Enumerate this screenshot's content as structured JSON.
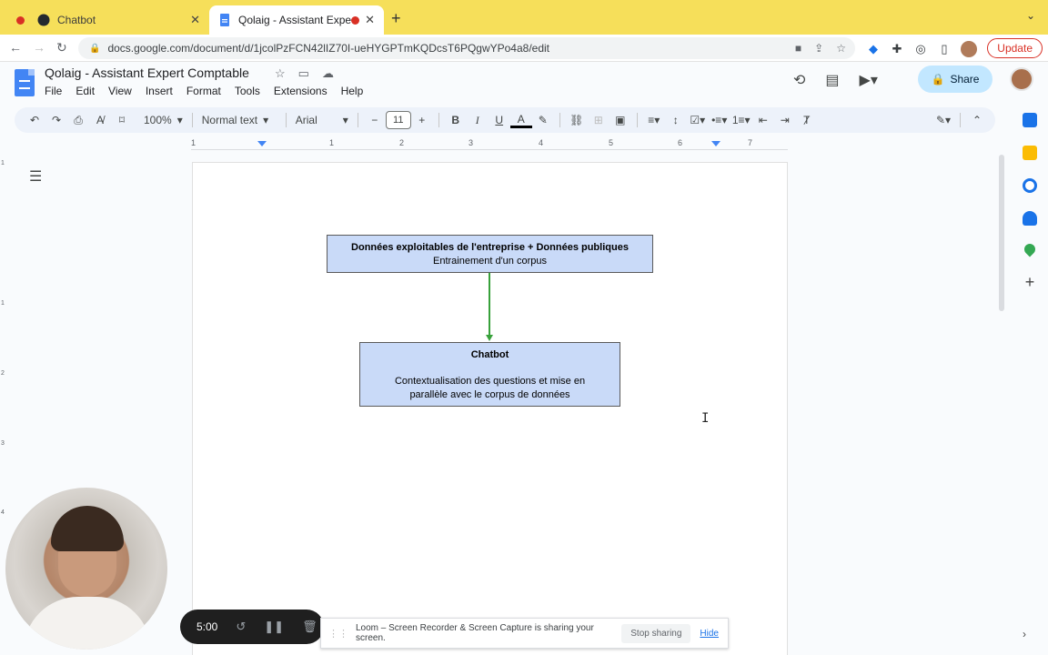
{
  "browser": {
    "tabs": [
      {
        "title": "Chatbot",
        "active": false
      },
      {
        "title": "Qolaig - Assistant Expert Co",
        "active": true
      }
    ],
    "url": "docs.google.com/document/d/1jcolPzFCN42lIZ70I-ueHYGPTmKQDcsT6PQgwYPo4a8/edit",
    "update_label": "Update"
  },
  "docs": {
    "title": "Qolaig - Assistant Expert Comptable",
    "menu": [
      "File",
      "Edit",
      "View",
      "Insert",
      "Format",
      "Tools",
      "Extensions",
      "Help"
    ],
    "share_label": "Share",
    "toolbar": {
      "zoom": "100%",
      "style": "Normal text",
      "font": "Arial",
      "font_size": "11"
    },
    "ruler_numbers": [
      "1",
      "1",
      "2",
      "3",
      "4",
      "5",
      "6",
      "7"
    ],
    "vruler_numbers": [
      "1",
      "1",
      "2",
      "3",
      "4"
    ]
  },
  "diagram": {
    "box1": {
      "title": "Données exploitables de l'entreprise + Données publiques",
      "subtitle": "Entrainement d'un corpus"
    },
    "box2": {
      "title": "Chatbot",
      "line1": "Contextualisation des questions et mise en",
      "line2": "parallèle avec le corpus de données"
    },
    "connector_color": "#38a13b",
    "box_fill": "#c9daf8"
  },
  "loom": {
    "timer": "5:00",
    "message": "Loom – Screen Recorder & Screen Capture is sharing your screen.",
    "stop_label": "Stop sharing",
    "hide_label": "Hide"
  },
  "colors": {
    "tabstrip": "#f6df5a",
    "share": "#c2e7ff",
    "update": "#d93025"
  }
}
